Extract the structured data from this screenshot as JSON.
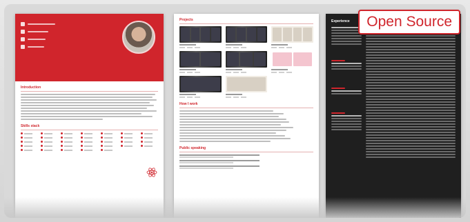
{
  "badge": {
    "label": "Open Source",
    "color": "#d0252c"
  },
  "colors": {
    "accent": "#d0252c",
    "dark_page": "#1f1f1f"
  },
  "page1": {
    "sections": [
      "Introduction",
      "Skills stack"
    ],
    "contact_icons": [
      "email-icon",
      "phone-icon",
      "linkedin-icon",
      "github-icon"
    ],
    "react_icon": "react-logo-icon"
  },
  "page2": {
    "sections": [
      "Projects",
      "How I work",
      "Public speaking"
    ]
  },
  "page3": {
    "sections": [
      "Experience"
    ]
  }
}
